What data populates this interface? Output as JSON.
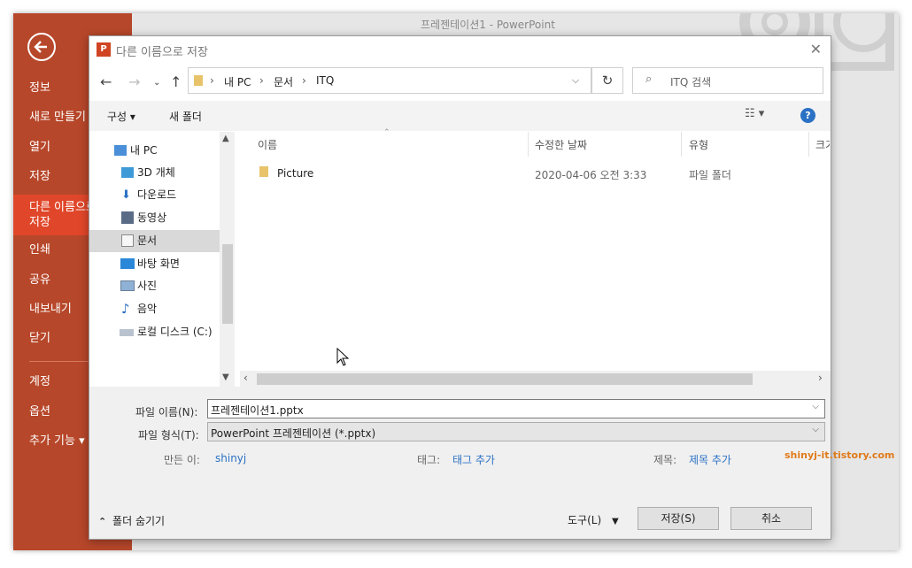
{
  "window": {
    "title": "프레젠테이션1 - PowerPoint"
  },
  "backstage": {
    "items": [
      {
        "label": "정보"
      },
      {
        "label": "새로 만들기"
      },
      {
        "label": "열기"
      },
      {
        "label": "저장"
      },
      {
        "label": "다른 이름으로 저장"
      },
      {
        "label": "인쇄"
      },
      {
        "label": "공유"
      },
      {
        "label": "내보내기"
      },
      {
        "label": "닫기"
      },
      {
        "label": "계정"
      },
      {
        "label": "옵션"
      },
      {
        "label": "추가 기능 ▾"
      }
    ],
    "accent": "#b7472a",
    "active_color": "#e0472a"
  },
  "dialog": {
    "title": "다른 이름으로 저장",
    "address": {
      "parts": [
        "내 PC",
        "문서",
        "ITQ"
      ]
    },
    "search_placeholder": "ITQ 검색",
    "toolbar": {
      "organize": "구성 ▾",
      "new_folder": "새 폴더"
    },
    "tree": [
      {
        "label": "내 PC",
        "icon": "pc-icon"
      },
      {
        "label": "3D 개체",
        "icon": "3d-objects-icon"
      },
      {
        "label": "다운로드",
        "icon": "download-icon"
      },
      {
        "label": "동영상",
        "icon": "video-icon"
      },
      {
        "label": "문서",
        "icon": "document-icon",
        "selected": true
      },
      {
        "label": "바탕 화면",
        "icon": "desktop-icon"
      },
      {
        "label": "사진",
        "icon": "pictures-icon"
      },
      {
        "label": "음악",
        "icon": "music-icon"
      },
      {
        "label": "로컬 디스크 (C:)",
        "icon": "drive-icon"
      }
    ],
    "columns": [
      "이름",
      "수정한 날짜",
      "유형",
      "크기"
    ],
    "files": [
      {
        "name": "Picture",
        "modified": "2020-04-06 오전 3:33",
        "type": "파일 폴더"
      }
    ],
    "filename_label": "파일 이름(N):",
    "filename_value": "프레젠테이션1.pptx",
    "filetype_label": "파일 형식(T):",
    "filetype_value": "PowerPoint 프레젠테이션 (*.pptx)",
    "author_label": "만든 이:",
    "author_value": "shinyj",
    "tags_label": "태그:",
    "tags_value": "태그 추가",
    "title_label": "제목:",
    "title_value": "제목 추가",
    "hide_folders": "폴더 숨기기",
    "tools": "도구(L)",
    "save": "저장(S)",
    "cancel": "취소"
  },
  "watermark": "shinyj-it.tistory.com"
}
